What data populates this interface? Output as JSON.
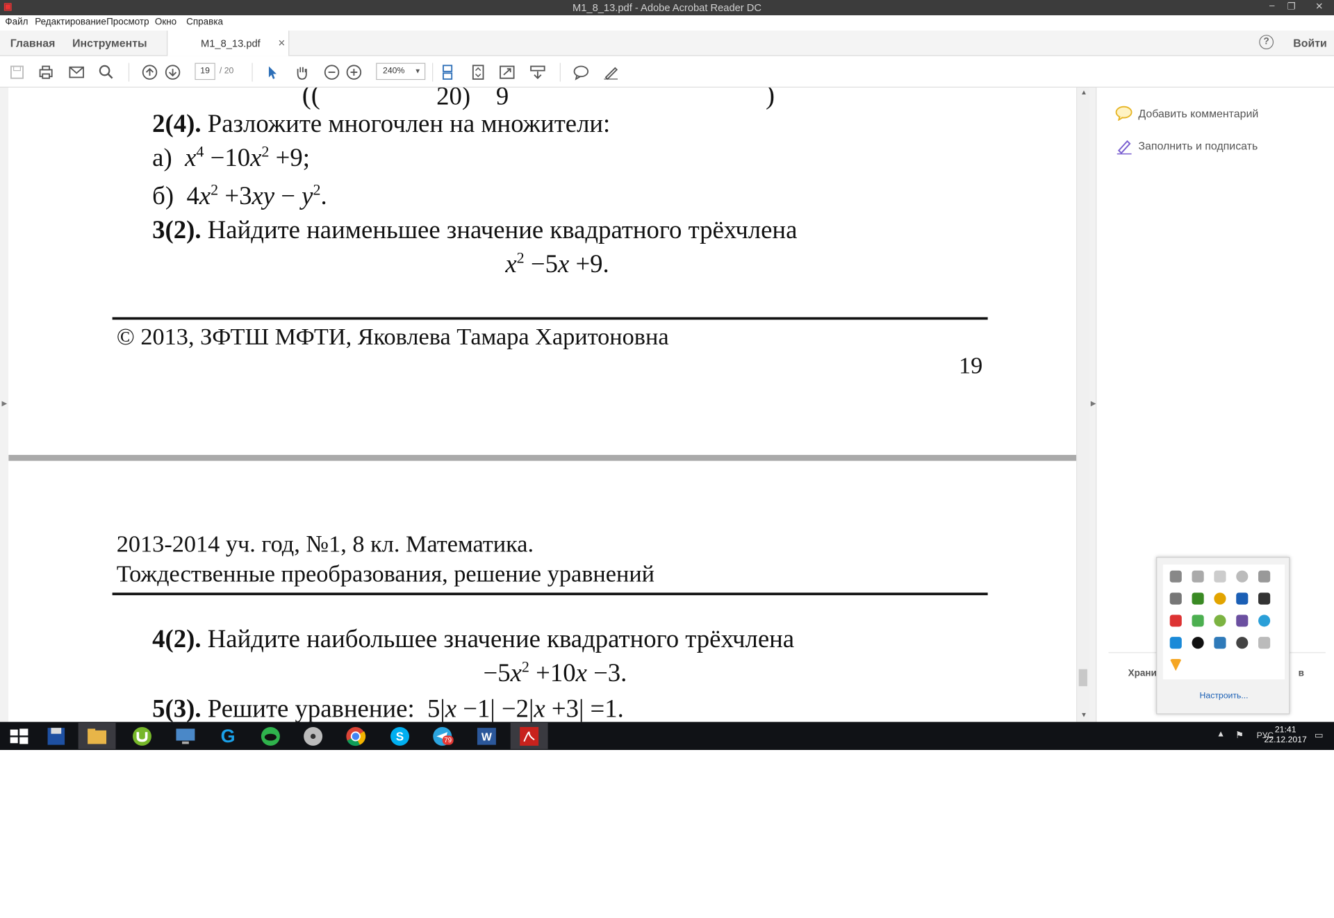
{
  "window": {
    "title": "M1_8_13.pdf - Adobe Acrobat Reader DC",
    "minimize_glyph": "–",
    "restore_glyph": "❐",
    "close_glyph": "✕"
  },
  "menu": [
    "Файл",
    "Редактирование",
    "Просмотр",
    "Окно",
    "Справка"
  ],
  "tabs": {
    "home": "Главная",
    "tools": "Инструменты",
    "document": "M1_8_13.pdf",
    "close": "×",
    "help": "?",
    "signin": "Войти"
  },
  "toolbar": {
    "page_current": "19",
    "page_total": "/ 20",
    "zoom": "240%"
  },
  "doc": {
    "top_frag1": "((",
    "top_frag2": "20)",
    "top_frag3": "9",
    "top_frag4": ")",
    "p2_num": "2(4).",
    "p2_text": "Разложите многочлен на множители:",
    "p2a_label": "а)",
    "p2b_label": "б)",
    "p3_num": "3(2).",
    "p3_text": "Найдите наименьшее значение квадратного трёхчлена",
    "copyright": "© 2013, ЗФТШ МФТИ, Яковлева Тамара Харитоновна",
    "page_num": "19",
    "header1": "2013-2014 уч. год, №1, 8 кл. Математика.",
    "header2": "Тождественные преобразования, решение уравнений",
    "p4_num": "4(2).",
    "p4_text": "Найдите наибольшее значение квадратного трёхчлена",
    "p5_num": "5(3).",
    "p5_text": "Решите уравнение:"
  },
  "right_panel": {
    "add_comment": "Добавить комментарий",
    "fill_sign": "Заполнить и подписать",
    "storage_frag1": "Храни",
    "storage_frag2": "в"
  },
  "tray": {
    "customize": "Настроить..."
  },
  "taskbar": {
    "lang": "РУС",
    "time": "21:41",
    "date": "22.12.2017",
    "telegram_badge": "79"
  },
  "colors": {
    "accent": "#2d6fb8",
    "taskbar": "#101216",
    "titlebar": "#3c3c3c",
    "pdf_red": "#c8221d"
  }
}
